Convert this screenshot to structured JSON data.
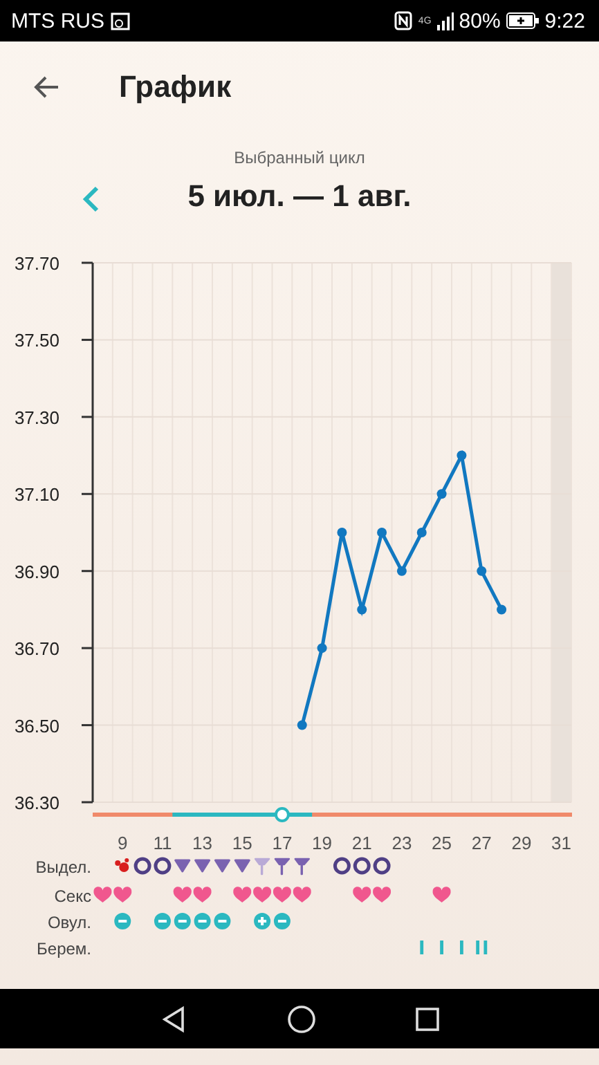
{
  "status_bar": {
    "carrier": "MTS RUS",
    "network": "4G",
    "battery": "80%",
    "time": "9:22"
  },
  "header": {
    "title": "График"
  },
  "cycle": {
    "caption": "Выбранный цикл",
    "range": "5 июл. — 1 авг."
  },
  "chart": {
    "chart_data": {
      "type": "line",
      "x": [
        18,
        19,
        20,
        21,
        22,
        23,
        24,
        25,
        26,
        27,
        28
      ],
      "series": [
        {
          "color": "#1178c0",
          "marker": "o",
          "values": [
            36.5,
            36.7,
            37.0,
            36.8,
            37.0,
            36.9,
            37.0,
            37.1,
            37.2,
            36.9,
            36.8
          ]
        }
      ],
      "xlim": [
        7.5,
        31.5
      ],
      "ylim": [
        36.3,
        37.7
      ],
      "grid": true,
      "bands": [
        {
          "axis": "x",
          "from": 30.5,
          "to": 31.5,
          "color": "#e9e1da"
        }
      ],
      "yticks": [
        {
          "value": 36.3,
          "label": "36.30"
        },
        {
          "value": 36.5,
          "label": "36.50"
        },
        {
          "value": 36.7,
          "label": "36.70"
        },
        {
          "value": 36.9,
          "label": "36.90"
        },
        {
          "value": 37.1,
          "label": "37.10"
        },
        {
          "value": 37.3,
          "label": "37.30"
        },
        {
          "value": 37.5,
          "label": "37.50"
        },
        {
          "value": 37.7,
          "label": "37.70"
        }
      ],
      "xticks": [
        9,
        11,
        13,
        15,
        17,
        19,
        21,
        23,
        25,
        27,
        29,
        31
      ]
    },
    "timeline": [
      {
        "kind": "normal",
        "selected": false
      },
      {
        "kind": "normal",
        "selected": false
      },
      {
        "kind": "normal",
        "selected": false
      },
      {
        "kind": "normal",
        "selected": false
      },
      {
        "kind": "fertile",
        "selected": false
      },
      {
        "kind": "fertile",
        "selected": false
      },
      {
        "kind": "fertile",
        "selected": false
      },
      {
        "kind": "fertile",
        "selected": false
      },
      {
        "kind": "fertile",
        "selected": false
      },
      {
        "kind": "fertile",
        "selected": true
      },
      {
        "kind": "fertile",
        "selected": false
      },
      {
        "kind": "normal",
        "selected": false
      },
      {
        "kind": "normal",
        "selected": false
      },
      {
        "kind": "normal",
        "selected": false
      },
      {
        "kind": "normal",
        "selected": false
      },
      {
        "kind": "normal",
        "selected": false
      },
      {
        "kind": "normal",
        "selected": false
      },
      {
        "kind": "normal",
        "selected": false
      },
      {
        "kind": "normal",
        "selected": false
      },
      {
        "kind": "normal",
        "selected": false
      },
      {
        "kind": "normal",
        "selected": false
      },
      {
        "kind": "normal",
        "selected": false
      },
      {
        "kind": "normal",
        "selected": false
      },
      {
        "kind": "normal",
        "selected": false
      }
    ]
  },
  "rows": [
    {
      "label": "Выдел.",
      "marks": [
        {
          "kind": "none"
        },
        {
          "kind": "blood"
        },
        {
          "kind": "ring"
        },
        {
          "kind": "ring"
        },
        {
          "kind": "drop"
        },
        {
          "kind": "drop"
        },
        {
          "kind": "drop"
        },
        {
          "kind": "drop"
        },
        {
          "kind": "funnel_light"
        },
        {
          "kind": "funnel"
        },
        {
          "kind": "funnel"
        },
        {
          "kind": "none"
        },
        {
          "kind": "ring"
        },
        {
          "kind": "ring"
        },
        {
          "kind": "ring"
        }
      ]
    },
    {
      "label": "Секс",
      "marks": [
        {
          "kind": "heart"
        },
        {
          "kind": "heart"
        },
        {
          "kind": "none"
        },
        {
          "kind": "none"
        },
        {
          "kind": "heart"
        },
        {
          "kind": "heart"
        },
        {
          "kind": "none"
        },
        {
          "kind": "heart"
        },
        {
          "kind": "heart"
        },
        {
          "kind": "heart"
        },
        {
          "kind": "heart"
        },
        {
          "kind": "none"
        },
        {
          "kind": "none"
        },
        {
          "kind": "heart"
        },
        {
          "kind": "heart"
        },
        {
          "kind": "none"
        },
        {
          "kind": "none"
        },
        {
          "kind": "heart"
        }
      ]
    },
    {
      "label": "Овул.",
      "marks": [
        {
          "kind": "none"
        },
        {
          "kind": "negative"
        },
        {
          "kind": "none"
        },
        {
          "kind": "negative"
        },
        {
          "kind": "negative"
        },
        {
          "kind": "negative"
        },
        {
          "kind": "negative"
        },
        {
          "kind": "none"
        },
        {
          "kind": "positive"
        },
        {
          "kind": "negative"
        }
      ]
    },
    {
      "label": "Берем.",
      "marks": [
        {
          "kind": "none"
        },
        {
          "kind": "none"
        },
        {
          "kind": "none"
        },
        {
          "kind": "none"
        },
        {
          "kind": "none"
        },
        {
          "kind": "none"
        },
        {
          "kind": "none"
        },
        {
          "kind": "none"
        },
        {
          "kind": "none"
        },
        {
          "kind": "none"
        },
        {
          "kind": "none"
        },
        {
          "kind": "none"
        },
        {
          "kind": "none"
        },
        {
          "kind": "none"
        },
        {
          "kind": "none"
        },
        {
          "kind": "none"
        },
        {
          "kind": "single"
        },
        {
          "kind": "single"
        },
        {
          "kind": "single"
        },
        {
          "kind": "double"
        }
      ]
    }
  ]
}
